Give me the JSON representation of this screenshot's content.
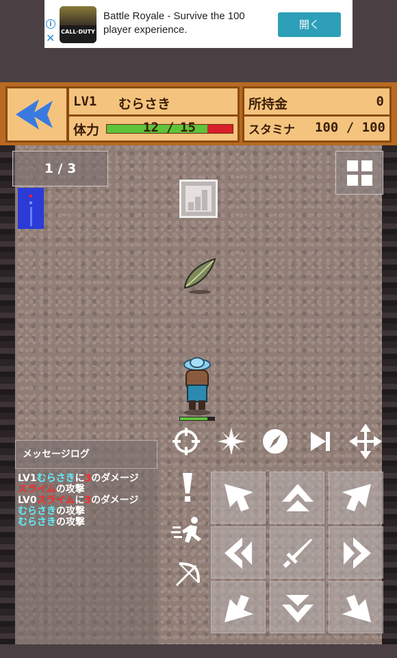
{
  "ad": {
    "title": "Battle Royale - Survive the 100 player experience.",
    "logo_text": "CALL·DUTY",
    "button": "開く",
    "info_icon": "info-icon",
    "close_icon": "close-icon"
  },
  "hud": {
    "back_icon": "double-left-arrow-icon",
    "level": "LV1",
    "character_name": "むらさき",
    "hp_label": "体力",
    "hp_current": "12",
    "hp_separator": "/",
    "hp_max": "15",
    "hp_fraction": 0.8,
    "money_label": "所持金",
    "money_value": "0",
    "stamina_label": "スタミナ",
    "stamina_value": "100 / 100"
  },
  "field": {
    "floor_indicator": "1 / 3",
    "menu_icon": "grid-menu-icon"
  },
  "log": {
    "title": "メッセージログ",
    "lines": [
      {
        "parts": [
          {
            "t": "LV1",
            "c": "plain"
          },
          {
            "t": "むらさき",
            "c": "name"
          },
          {
            "t": "に",
            "c": "plain"
          },
          {
            "t": "3",
            "c": "dmg"
          },
          {
            "t": "のダメージ",
            "c": "plain"
          }
        ]
      },
      {
        "parts": [
          {
            "t": "スライム",
            "c": "enemy"
          },
          {
            "t": "の攻撃",
            "c": "plain"
          }
        ]
      },
      {
        "parts": [
          {
            "t": "LV0",
            "c": "plain"
          },
          {
            "t": "スライム",
            "c": "enemy"
          },
          {
            "t": "に",
            "c": "plain"
          },
          {
            "t": "3",
            "c": "dmg"
          },
          {
            "t": "のダメージ",
            "c": "plain"
          }
        ]
      },
      {
        "parts": [
          {
            "t": "むらさき",
            "c": "name"
          },
          {
            "t": "の攻撃",
            "c": "plain"
          }
        ]
      },
      {
        "parts": [
          {
            "t": "むらさき",
            "c": "name"
          },
          {
            "t": "の攻撃",
            "c": "plain"
          }
        ]
      }
    ]
  },
  "colors": {
    "hp_fill": "#5ec43a",
    "hp_empty": "#d8202a",
    "name_text": "#5ff0ff",
    "enemy_text": "#ff2a2a",
    "hud_wood": "#f4c37e",
    "back_arrow": "#3a7ae0"
  },
  "actions": [
    "target-icon",
    "sparkle-icon",
    "compass-icon",
    "skip-icon",
    "move-arrows-icon",
    "exclamation-icon",
    "dash-runner-icon",
    "bow-icon"
  ],
  "dpad": [
    "up-left",
    "up",
    "up-right",
    "left",
    "attack-sword",
    "right",
    "down-left",
    "down",
    "down-right"
  ]
}
